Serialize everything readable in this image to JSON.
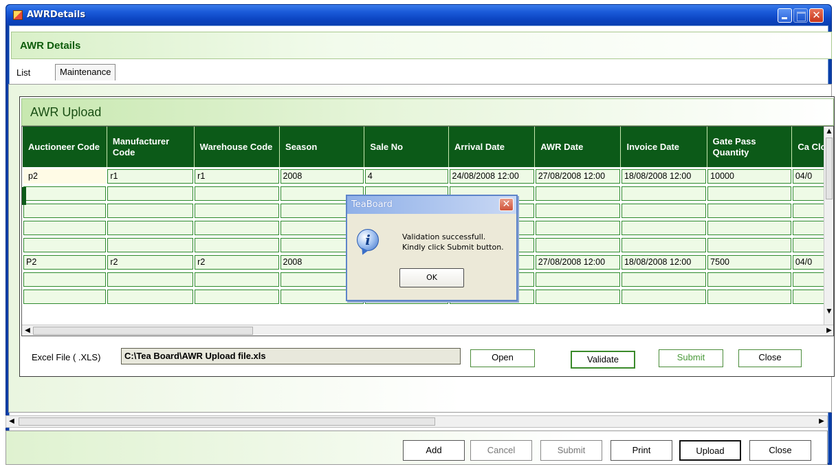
{
  "window": {
    "title": "AWRDetails"
  },
  "header": {
    "title": "AWR Details"
  },
  "tabs": [
    {
      "label": "List"
    },
    {
      "label": "Maintenance"
    }
  ],
  "upload": {
    "title": "AWR Upload",
    "columns": [
      "Auctioneer Code",
      "Manufacturer Code",
      "Warehouse Code",
      "Season",
      "Sale No",
      "Arrival Date",
      "AWR Date",
      "Invoice Date",
      "Gate Pass Quantity",
      "Ca Clo"
    ],
    "rows": [
      [
        "p2",
        "r1",
        "r1",
        "2008",
        "4",
        "24/08/2008 12:00",
        "27/08/2008 12:00",
        "18/08/2008 12:00",
        "10000",
        "04/0"
      ],
      [
        "",
        "",
        "",
        "",
        "",
        "",
        "",
        "",
        "",
        ""
      ],
      [
        "",
        "",
        "",
        "",
        "",
        "",
        "",
        "",
        "",
        ""
      ],
      [
        "",
        "",
        "",
        "",
        "",
        "",
        "",
        "",
        "",
        ""
      ],
      [
        "",
        "",
        "",
        "",
        "",
        "",
        "",
        "",
        "",
        ""
      ],
      [
        "P2",
        "r2",
        "r2",
        "2008",
        "",
        "2:00",
        "27/08/2008 12:00",
        "18/08/2008 12:00",
        "7500",
        "04/0"
      ],
      [
        "",
        "",
        "",
        "",
        "",
        "",
        "",
        "",
        "",
        ""
      ],
      [
        "",
        "",
        "",
        "",
        "",
        "",
        "",
        "",
        "",
        ""
      ]
    ],
    "excel_label": "Excel File ( .XLS)",
    "excel_path": "C:\\Tea Board\\AWR Upload file.xls",
    "buttons": {
      "open": "Open",
      "validate": "Validate",
      "submit": "Submit",
      "close": "Close"
    }
  },
  "bottom_buttons": {
    "add": "Add",
    "cancel": "Cancel",
    "submit": "Submit",
    "print": "Print",
    "upload": "Upload",
    "close": "Close"
  },
  "dialog": {
    "title": "TeaBoard",
    "line1": "Validation successfull.",
    "line2": "Kindly click Submit button.",
    "ok": "OK",
    "close_glyph": "✕",
    "icon_glyph": "i"
  },
  "glyphs": {
    "close": "✕",
    "up": "▲",
    "down": "▼",
    "left": "◀",
    "right": "▶"
  },
  "colors": {
    "grid_header": "#0c5a18",
    "cell_border": "#2e8a2e",
    "titlebar": "#0a3fa8"
  }
}
